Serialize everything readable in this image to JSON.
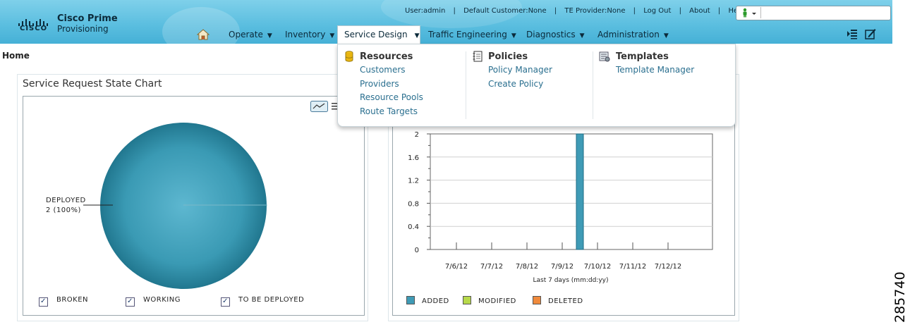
{
  "brand": {
    "title": "Cisco Prime",
    "subtitle": "Provisioning",
    "logo_word": "CISCO"
  },
  "toplinks": {
    "user": "User:admin",
    "customer": "Default Customer:None",
    "te_provider": "TE Provider:None",
    "logout": "Log Out",
    "about": "About",
    "help": "Help",
    "separator": "|"
  },
  "search": {
    "value": "",
    "placeholder": ""
  },
  "nav": {
    "items": [
      {
        "label": "Operate"
      },
      {
        "label": "Inventory"
      },
      {
        "label": "Service Design"
      },
      {
        "label": "Traffic Engineering"
      },
      {
        "label": "Diagnostics"
      },
      {
        "label": "Administration"
      }
    ],
    "caret": "▼"
  },
  "breadcrumb": "Home",
  "dropdown": {
    "resources": {
      "title": "Resources",
      "links": [
        "Customers",
        "Providers",
        "Resource Pools",
        "Route Targets"
      ]
    },
    "policies": {
      "title": "Policies",
      "links": [
        "Policy Manager",
        "Create Policy"
      ]
    },
    "templates": {
      "title": "Templates",
      "links": [
        "Template Manager"
      ]
    }
  },
  "left_panel": {
    "title": "Service Request State Chart",
    "pie_label_line1": "DEPLOYED",
    "pie_label_line2": "2 (100%)",
    "legend": [
      "BROKEN",
      "WORKING",
      "TO BE DEPLOYED"
    ],
    "check": "✓"
  },
  "chart_data": [
    {
      "type": "pie",
      "title": "Service Request State Chart",
      "slices": [
        {
          "label": "DEPLOYED",
          "value": 2,
          "percent": 100
        }
      ],
      "legend": [
        "BROKEN",
        "WORKING",
        "TO BE DEPLOYED"
      ]
    },
    {
      "type": "bar",
      "categories": [
        "7/6/12",
        "7/7/12",
        "7/8/12",
        "7/9/12",
        "7/10/12",
        "7/11/12",
        "7/12/12"
      ],
      "bar_positions": [
        3.5
      ],
      "series": [
        {
          "name": "ADDED",
          "color": "#3f9bb6",
          "values": [
            2
          ]
        },
        {
          "name": "MODIFIED",
          "color": "#b7d94a",
          "values": [
            0
          ]
        },
        {
          "name": "DELETED",
          "color": "#f08a3c",
          "values": [
            0
          ]
        }
      ],
      "xlabel": "Last 7 days (mm:dd:yy)",
      "ylim": [
        0,
        2
      ],
      "yticks": [
        "0",
        "0.4",
        "0.8",
        "1.2",
        "1.6",
        "2"
      ],
      "grid": true,
      "legend_position": "bottom-left"
    }
  ],
  "figure_id": "285740",
  "colors": {
    "header": "#5cbfe0",
    "pie": "#3a9ab4",
    "link": "#2a6f8f"
  }
}
